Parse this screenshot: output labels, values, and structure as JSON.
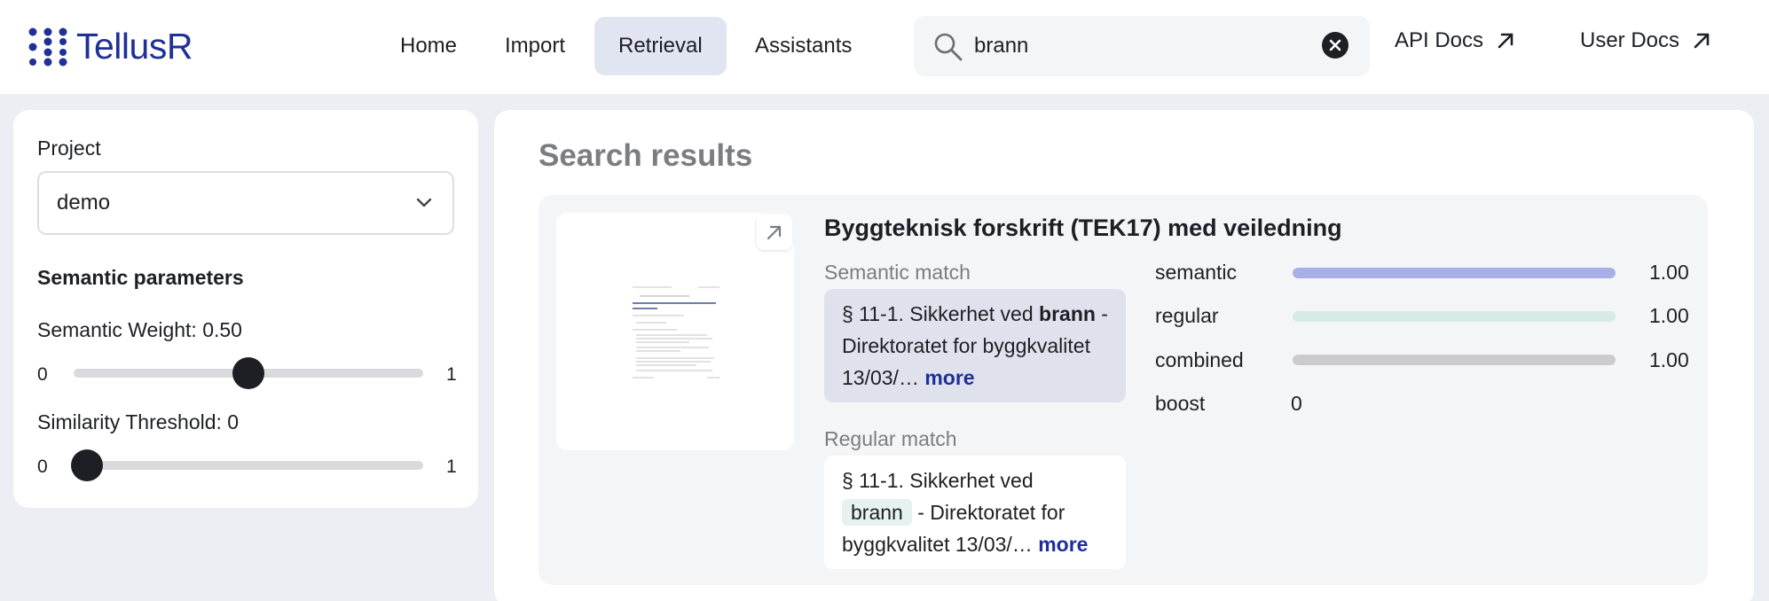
{
  "app": {
    "name": "TellusR"
  },
  "nav": {
    "items": [
      {
        "label": "Home",
        "active": false
      },
      {
        "label": "Import",
        "active": false
      },
      {
        "label": "Retrieval",
        "active": true
      },
      {
        "label": "Assistants",
        "active": false
      }
    ]
  },
  "search": {
    "value": "brann",
    "placeholder": ""
  },
  "links": {
    "api_docs": "API Docs",
    "user_docs": "User Docs"
  },
  "sidebar": {
    "project_label": "Project",
    "project_value": "demo",
    "semantic_heading": "Semantic parameters",
    "semantic_weight": {
      "label": "Semantic Weight: 0.50",
      "value": 0.5,
      "min_label": "0",
      "max_label": "1"
    },
    "similarity_threshold": {
      "label": "Similarity Threshold: 0",
      "value": 0,
      "min_label": "0",
      "max_label": "1"
    }
  },
  "main": {
    "title": "Search results",
    "results": [
      {
        "title": "Byggteknisk forskrift (TEK17) med veiledning",
        "semantic_match_label": "Semantic match",
        "semantic_snippet": {
          "before": "§ 11-1. Sikkerhet ved ",
          "highlight": "brann",
          "after": " - Direktoratet for byggkvalitet 13/03/…",
          "more": "more"
        },
        "regular_match_label": "Regular match",
        "regular_snippet": {
          "before": "§ 11-1. Sikkerhet ved ",
          "highlight": "brann",
          "after": " - Direktoratet for byggkvalitet 13/03/…",
          "more": "more"
        },
        "scores": [
          {
            "name": "semantic",
            "value": 1.0,
            "display": "1.00",
            "color": "#a8afe6"
          },
          {
            "name": "regular",
            "value": 1.0,
            "display": "1.00",
            "color": "#d6ebe6"
          },
          {
            "name": "combined",
            "value": 1.0,
            "display": "1.00",
            "color": "#cbcbcc"
          }
        ],
        "boost": {
          "name": "boost",
          "value": "0"
        }
      }
    ]
  }
}
